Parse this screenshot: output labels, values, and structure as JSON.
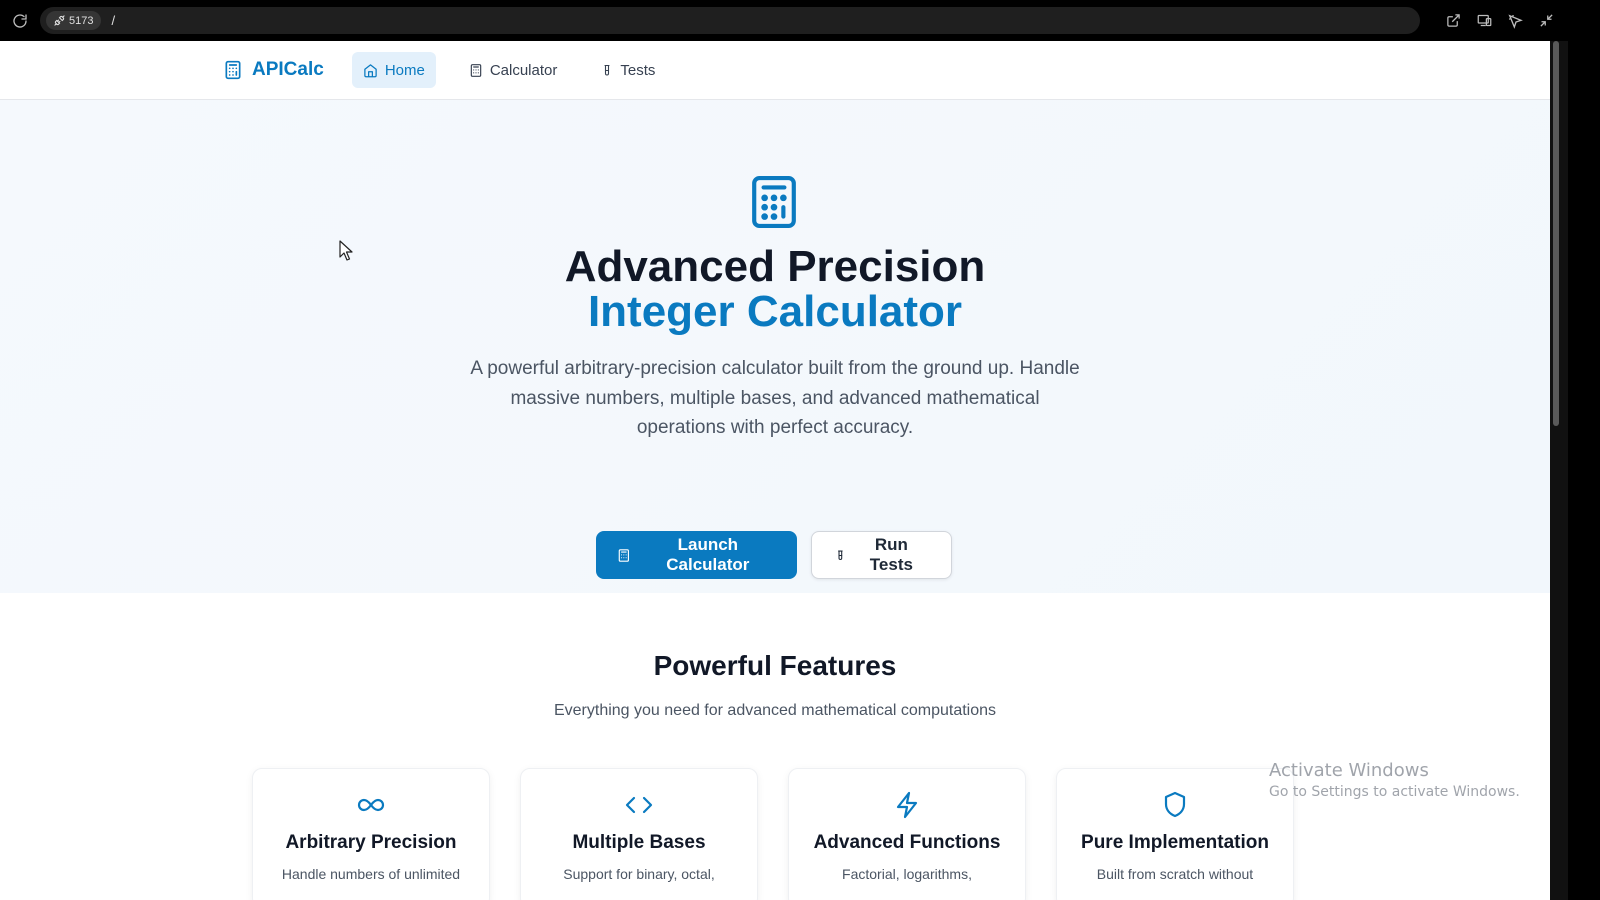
{
  "browser": {
    "port": "5173",
    "path": "/"
  },
  "nav": {
    "brand": "APICalc",
    "items": [
      {
        "label": "Home",
        "active": true
      },
      {
        "label": "Calculator",
        "active": false
      },
      {
        "label": "Tests",
        "active": false
      }
    ]
  },
  "hero": {
    "title_line1": "Advanced Precision",
    "title_line2": "Integer Calculator",
    "description": "A powerful arbitrary-precision calculator built from the ground up. Handle massive numbers, multiple bases, and advanced mathematical operations with perfect accuracy.",
    "primary_button": "Launch Calculator",
    "secondary_button": "Run Tests"
  },
  "features": {
    "title": "Powerful Features",
    "subtitle": "Everything you need for advanced mathematical computations",
    "cards": [
      {
        "icon": "infinity-icon",
        "title": "Arbitrary Precision",
        "text": "Handle numbers of unlimited"
      },
      {
        "icon": "code-icon",
        "title": "Multiple Bases",
        "text": "Support for binary, octal,"
      },
      {
        "icon": "lightning-icon",
        "title": "Advanced Functions",
        "text": "Factorial, logarithms,"
      },
      {
        "icon": "shield-icon",
        "title": "Pure Implementation",
        "text": "Built from scratch without"
      }
    ]
  },
  "watermark": {
    "line1": "Activate Windows",
    "line2": "Go to Settings to activate Windows."
  },
  "colors": {
    "accent": "#0a7ac0",
    "nav_active_bg": "#e3f0fb",
    "hero_bg": "#f4f8fc"
  }
}
